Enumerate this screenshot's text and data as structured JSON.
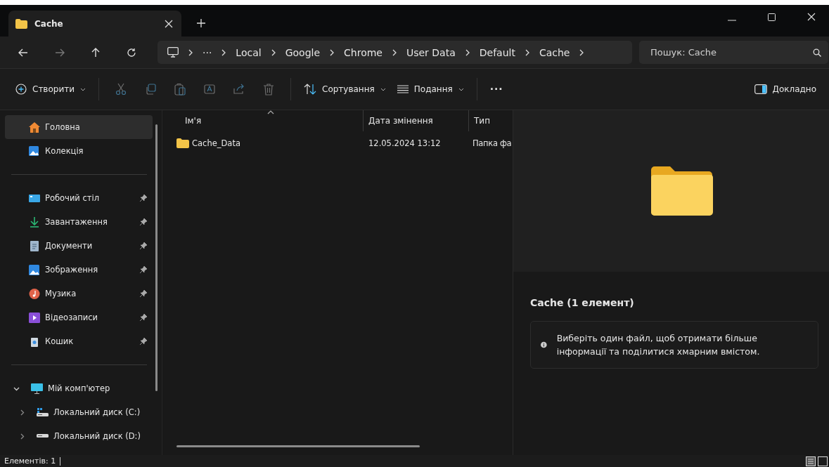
{
  "tab": {
    "title": "Cache",
    "selected": true
  },
  "address": {
    "crumbs": [
      "···",
      "Local",
      "Google",
      "Chrome",
      "User Data",
      "Default",
      "Cache"
    ]
  },
  "search": {
    "placeholder": "Пошук: Cache"
  },
  "toolbar": {
    "create": "Створити",
    "actions": [
      {
        "kind": "cut",
        "disabled": true
      },
      {
        "kind": "copy",
        "disabled": true
      },
      {
        "kind": "paste",
        "disabled": true
      },
      {
        "kind": "rename",
        "disabled": true
      },
      {
        "kind": "share",
        "disabled": true
      },
      {
        "kind": "delete",
        "disabled": true
      }
    ],
    "sort": "Сортування",
    "view": "Подання",
    "more": "···",
    "details": "Докладно"
  },
  "sidebar": {
    "top": [
      {
        "label": "Головна",
        "kind": "home",
        "selected": true
      },
      {
        "label": "Колекція",
        "kind": "gallery",
        "selected": false
      }
    ],
    "pinned": [
      {
        "label": "Робочий стіл",
        "kind": "desktop",
        "selected": false
      },
      {
        "label": "Завантаження",
        "kind": "download",
        "selected": false
      },
      {
        "label": "Документи",
        "kind": "document",
        "selected": false
      },
      {
        "label": "Зображення",
        "kind": "picture",
        "selected": false
      },
      {
        "label": "Музика",
        "kind": "music",
        "selected": false
      },
      {
        "label": "Відеозаписи",
        "kind": "video",
        "selected": false
      },
      {
        "label": "Кошик",
        "kind": "bin",
        "selected": false
      }
    ],
    "tree": [
      {
        "label": "Мій комп'ютер",
        "kind": "computer",
        "expanded": true,
        "children": [
          {
            "label": "Локальний диск (C:)",
            "kind": "systemdrive",
            "expanded": false
          },
          {
            "label": "Локальний диск (D:)",
            "kind": "drive",
            "expanded": false
          }
        ]
      }
    ]
  },
  "table": {
    "columns": [
      {
        "label": "Ім'я",
        "sorted": true
      },
      {
        "label": "Дата змінення",
        "sorted": false
      },
      {
        "label": "Тип",
        "sorted": false
      }
    ],
    "rows": [
      {
        "name": "Cache_Data",
        "modified": "12.05.2024 13:12",
        "type": "Папка фа"
      }
    ]
  },
  "details": {
    "title": "Cache (1 елемент)",
    "info": "Виберіть один файл, щоб отримати більше інформації та поділитися хмарним вмістом."
  },
  "status_bar": {
    "count": "Елементів: 1",
    "views": [
      {
        "kind": "details",
        "selected": true
      },
      {
        "kind": "tiles",
        "selected": false
      }
    ]
  }
}
